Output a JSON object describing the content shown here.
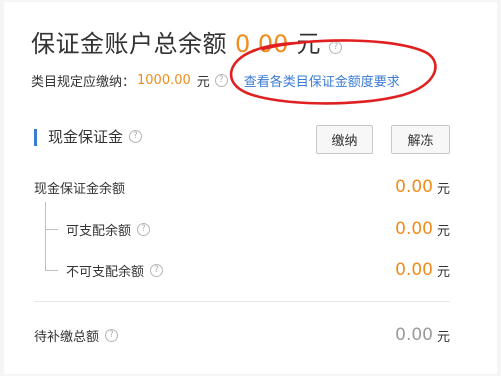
{
  "header": {
    "title": "保证金账户总余额",
    "total_amount": "0.00",
    "total_unit": "元",
    "help_icon": "question-circle-icon"
  },
  "requirement": {
    "label": "类目规定应缴纳：",
    "amount": "1000.00",
    "unit": "元",
    "link_text": "查看各类目保证金额度要求"
  },
  "annotation": {
    "oval_color": "#e02020"
  },
  "cash_section": {
    "title": "现金保证金",
    "pay_button": "缴纳",
    "unfreeze_button": "解冻",
    "accent_color": "#3a7bd5"
  },
  "rows": {
    "cash_balance": {
      "label": "现金保证金余额",
      "amount": "0.00",
      "unit": "元"
    },
    "available": {
      "label": "可支配余额",
      "amount": "0.00",
      "unit": "元"
    },
    "unavailable": {
      "label": "不可支配余额",
      "amount": "0.00",
      "unit": "元"
    },
    "pending": {
      "label": "待补缴总额",
      "amount": "0.00",
      "unit": "元"
    }
  },
  "colors": {
    "amount": "#f08c1c",
    "link": "#3a7bd5",
    "muted_amount": "#9a9a9a"
  }
}
